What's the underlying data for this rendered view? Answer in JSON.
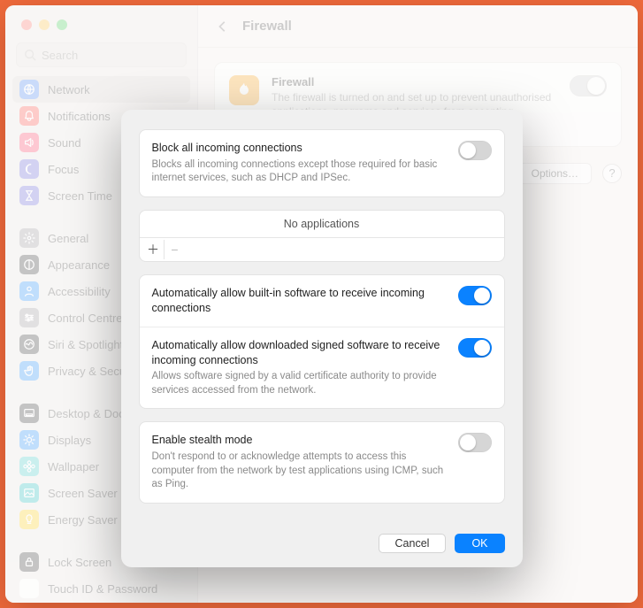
{
  "window": {
    "title": "Firewall"
  },
  "search": {
    "placeholder": "Search"
  },
  "sidebar": {
    "items": [
      {
        "label": "Network",
        "color": "#3478f6",
        "icon": "globe"
      },
      {
        "label": "Notifications",
        "color": "#ff3b30",
        "icon": "bell"
      },
      {
        "label": "Sound",
        "color": "#ff2d55",
        "icon": "speaker"
      },
      {
        "label": "Focus",
        "color": "#5856d6",
        "icon": "moon"
      },
      {
        "label": "Screen Time",
        "color": "#5856d6",
        "icon": "hourglass"
      },
      {
        "label": "General",
        "color": "#8e8e93",
        "icon": "gear"
      },
      {
        "label": "Appearance",
        "color": "#1c1c1e",
        "icon": "appearance"
      },
      {
        "label": "Accessibility",
        "color": "#0a84ff",
        "icon": "person"
      },
      {
        "label": "Control Centre",
        "color": "#8e8e93",
        "icon": "sliders"
      },
      {
        "label": "Siri & Spotlight",
        "color": "#1c1c1e",
        "icon": "siri"
      },
      {
        "label": "Privacy & Security",
        "color": "#0a84ff",
        "icon": "hand"
      },
      {
        "label": "Desktop & Dock",
        "color": "#1c1c1e",
        "icon": "dock"
      },
      {
        "label": "Displays",
        "color": "#0a84ff",
        "icon": "sun"
      },
      {
        "label": "Wallpaper",
        "color": "#34c8c8",
        "icon": "flower"
      },
      {
        "label": "Screen Saver",
        "color": "#06b8b8",
        "icon": "photo"
      },
      {
        "label": "Energy Saver",
        "color": "#ffcc00",
        "icon": "bulb"
      },
      {
        "label": "Lock Screen",
        "color": "#1c1c1e",
        "icon": "lock"
      },
      {
        "label": "Touch ID & Password",
        "color": "#ffffff",
        "icon": "finger"
      }
    ]
  },
  "card": {
    "title": "Firewall",
    "desc": "The firewall is turned on and set up to prevent unauthorised applications, programs and services from accepting incoming connections.",
    "on": true
  },
  "buttons": {
    "options": "Options…",
    "help": "?"
  },
  "sheet": {
    "block_all": {
      "title": "Block all incoming connections",
      "desc": "Blocks all incoming connections except those required for basic internet services, such as DHCP and IPSec.",
      "on": false
    },
    "applications": {
      "empty_label": "No applications"
    },
    "auto_builtin": {
      "title": "Automatically allow built-in software to receive incoming connections",
      "on": true
    },
    "auto_signed": {
      "title": "Automatically allow downloaded signed software to receive incoming connections",
      "desc": "Allows software signed by a valid certificate authority to provide services accessed from the network.",
      "on": true
    },
    "stealth": {
      "title": "Enable stealth mode",
      "desc": "Don't respond to or acknowledge attempts to access this computer from the network by test applications using ICMP, such as Ping.",
      "on": false
    },
    "cancel": "Cancel",
    "ok": "OK"
  }
}
